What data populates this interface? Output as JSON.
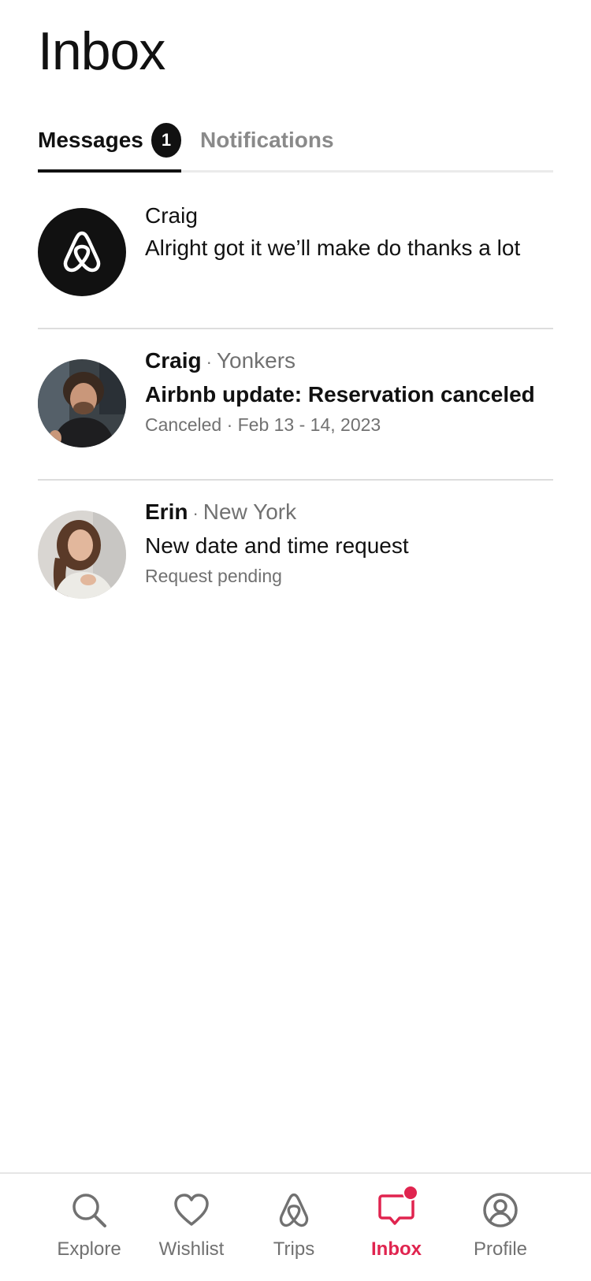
{
  "page": {
    "title": "Inbox"
  },
  "tabs": [
    {
      "label": "Messages",
      "badge": "1",
      "active": true
    },
    {
      "label": "Notifications",
      "active": false
    }
  ],
  "threads": [
    {
      "sender": "Craig",
      "location": "",
      "message": "Alright got it we’ll make do thanks a lot",
      "status": "",
      "avatar": "airbnb-logo"
    },
    {
      "sender": "Craig",
      "location": "Yonkers",
      "message": "Airbnb update: Reservation canceled",
      "status": "Canceled · Feb 13 - 14, 2023",
      "avatar": "photo"
    },
    {
      "sender": "Erin",
      "location": "New York",
      "message": "New date and time request",
      "status": "Request pending",
      "avatar": "photo"
    }
  ],
  "separator": "·",
  "nav": [
    {
      "label": "Explore",
      "icon": "search-icon"
    },
    {
      "label": "Wishlist",
      "icon": "heart-icon"
    },
    {
      "label": "Trips",
      "icon": "airbnb-logo-icon"
    },
    {
      "label": "Inbox",
      "icon": "message-icon",
      "active": true,
      "has_notification": true
    },
    {
      "label": "Profile",
      "icon": "user-circle-icon"
    }
  ],
  "colors": {
    "accent": "#e0244f",
    "text": "#111111",
    "muted": "#717171"
  }
}
